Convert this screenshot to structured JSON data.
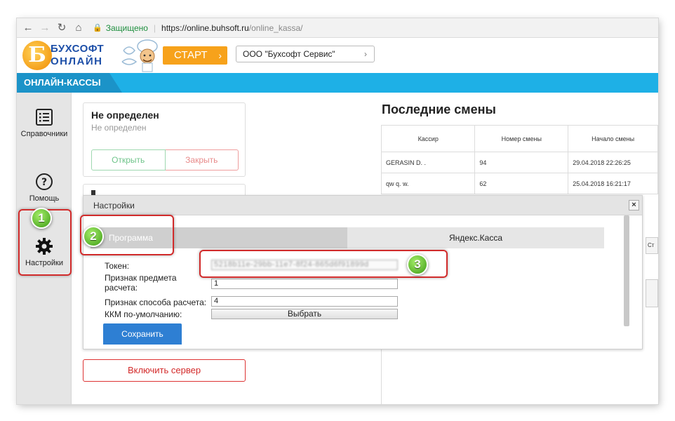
{
  "browser": {
    "secure_label": "Защищено",
    "url_host": "https://online.buhsoft.ru",
    "url_path": "/online_kassa/"
  },
  "header": {
    "logo_line1": "БУХСОФТ",
    "logo_line2": "ОНЛАЙН",
    "logo_letter": "Б",
    "start_label": "СТАРТ",
    "organization": "ООО \"Бухсофт Сервис\""
  },
  "band": {
    "title": "ОНЛАЙН-КАССЫ"
  },
  "sidebar": {
    "items": [
      {
        "label": "Справочники"
      },
      {
        "label": "Помощь"
      },
      {
        "label": "Настройки"
      }
    ]
  },
  "kkm_card": {
    "title": "Не определен",
    "subtitle": "Не определен",
    "open_label": "Открыть",
    "close_label": "Закрыть"
  },
  "server_button": "Включить сервер",
  "shifts": {
    "title": "Последние смены",
    "columns": [
      "Кассир",
      "Номер смены",
      "Начало смены"
    ],
    "rows": [
      [
        "GERASIN D. .",
        "94",
        "29.04.2018 22:26:25"
      ],
      [
        "qw q. w.",
        "62",
        "25.04.2018 16:21:17"
      ]
    ],
    "side_tab_label": "Ст"
  },
  "modal": {
    "title": "Настройки",
    "close_label": "×",
    "tabs": [
      "Программа",
      "Яндекс.Касса"
    ],
    "form": {
      "token_label": "Токен:",
      "token_value": "5218b11e-29bb-11e7-8f24-865d6f91899d",
      "subject_label_1": "Признак предмета",
      "subject_label_2": "расчета:",
      "subject_value": "1",
      "method_label": "Признак способа расчета:",
      "method_value": "4",
      "kkm_label": "ККМ по-умолчанию:",
      "pick_label": "Выбрать",
      "save_label": "Сохранить"
    }
  },
  "annotations": [
    "1",
    "2",
    "3"
  ],
  "colors": {
    "accent_blue": "#1eb0e6",
    "start_orange": "#f7a21b",
    "highlight_red": "#d12b2b",
    "marker_green": "#3c9a14"
  }
}
